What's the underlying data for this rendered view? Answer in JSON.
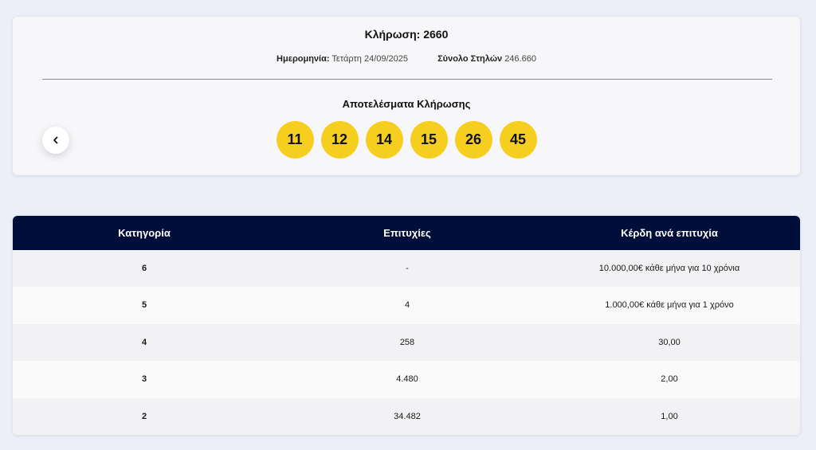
{
  "draw": {
    "title": "Κλήρωση: 2660",
    "date_label": "Ημερομηνία:",
    "date_value": "Τετάρτη 24/09/2025",
    "columns_label": "Σύνολο Στηλών",
    "columns_value": "246.660",
    "results_title": "Αποτελέσματα Κλήρωσης",
    "numbers": [
      "11",
      "12",
      "14",
      "15",
      "26",
      "45"
    ],
    "ball_color": "#f5ce1f",
    "prev_icon": "chevron-left-icon"
  },
  "table": {
    "headers": [
      "Κατηγορία",
      "Επιτυχίες",
      "Κέρδη ανά επιτυχία"
    ],
    "header_color": "#000e3a",
    "rows": [
      [
        "6",
        "-",
        "10.000,00€ κάθε μήνα για 10 χρόνια"
      ],
      [
        "5",
        "4",
        "1.000,00€ κάθε μήνα για 1 χρόνο"
      ],
      [
        "4",
        "258",
        "30,00"
      ],
      [
        "3",
        "4.480",
        "2,00"
      ],
      [
        "2",
        "34.482",
        "1,00"
      ]
    ]
  }
}
